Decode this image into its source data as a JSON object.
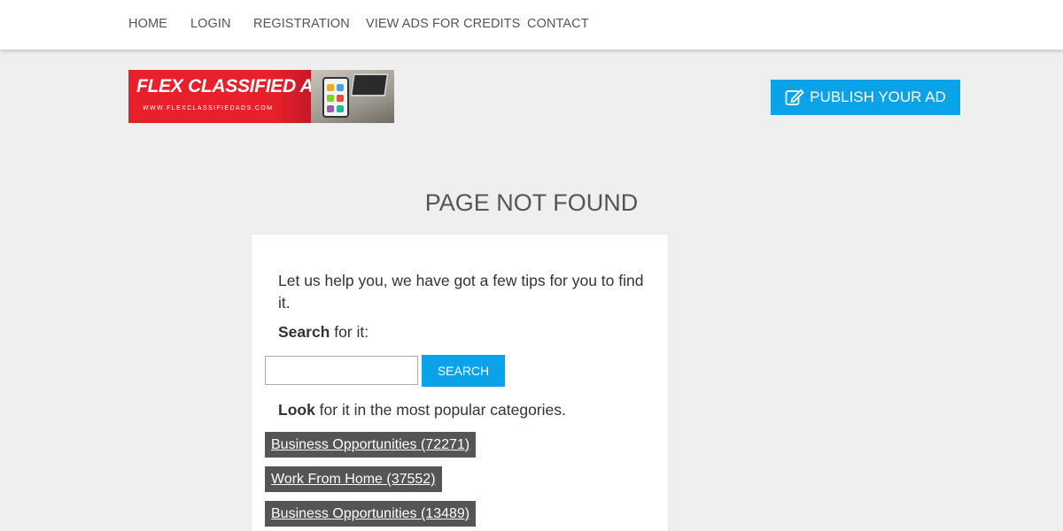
{
  "nav": {
    "items": [
      "HOME",
      "LOGIN",
      "REGISTRATION",
      "VIEW ADS FOR CREDITS",
      "CONTACT"
    ]
  },
  "logo": {
    "title": "FLEX CLASSIFIED ADS",
    "url": "WWW.FLEXCLASSIFIEDADS.COM"
  },
  "publish_button": {
    "label": "PUBLISH YOUR AD",
    "icon": "edit-icon"
  },
  "page_title": "PAGE NOT FOUND",
  "tips": {
    "intro": "Let us help you, we have got a few tips for you to find it.",
    "search_bold": "Search",
    "search_rest": " for it:",
    "search_input_value": "",
    "search_button": "SEARCH",
    "look_bold": "Look",
    "look_rest": " for it in the most popular categories."
  },
  "categories": [
    "Business Opportunities (72271)",
    "Work From Home (37552)",
    "Business Opportunities (13489)"
  ],
  "colors": {
    "accent": "#0aa3ea",
    "category_bg": "#555555",
    "page_bg": "#efefef",
    "logo_red": "#e8202b"
  }
}
